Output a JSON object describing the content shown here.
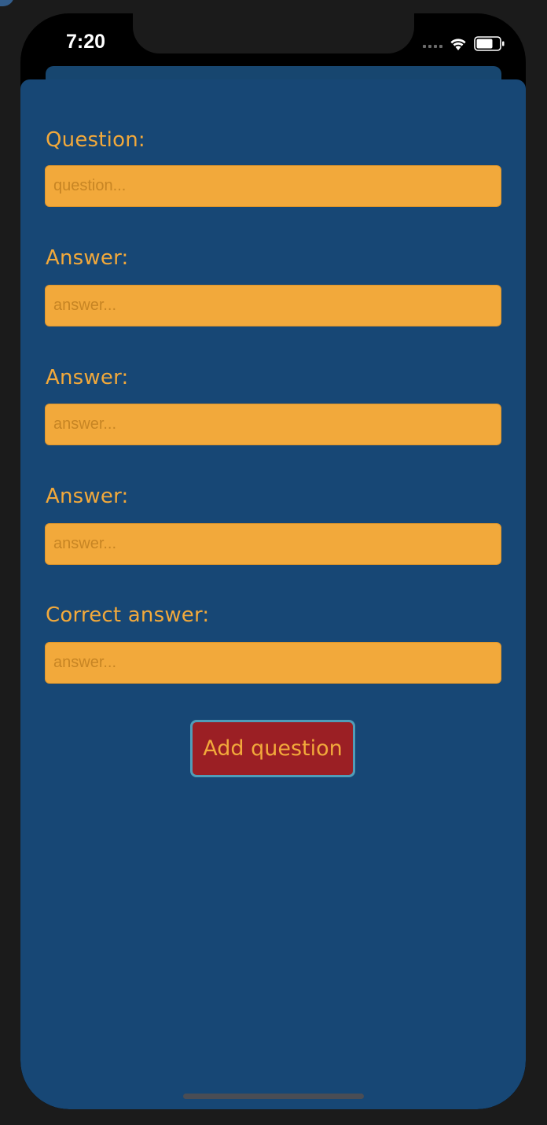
{
  "status_bar": {
    "time": "7:20"
  },
  "form": {
    "question_label": "Question:",
    "question_placeholder": "question...",
    "answer1_label": "Answer:",
    "answer1_placeholder": "answer...",
    "answer2_label": "Answer:",
    "answer2_placeholder": "answer...",
    "answer3_label": "Answer:",
    "answer3_placeholder": "answer...",
    "correct_label": "Correct answer:",
    "correct_placeholder": "answer...",
    "submit_label": "Add question"
  },
  "colors": {
    "sheet_background": "#174775",
    "accent_orange": "#f2a93b",
    "button_red": "#9b1f24",
    "button_border": "#4f9db8"
  },
  "icons": {
    "wifi": "wifi-icon",
    "battery": "battery-icon",
    "signal": "cellular-signal-icon"
  }
}
